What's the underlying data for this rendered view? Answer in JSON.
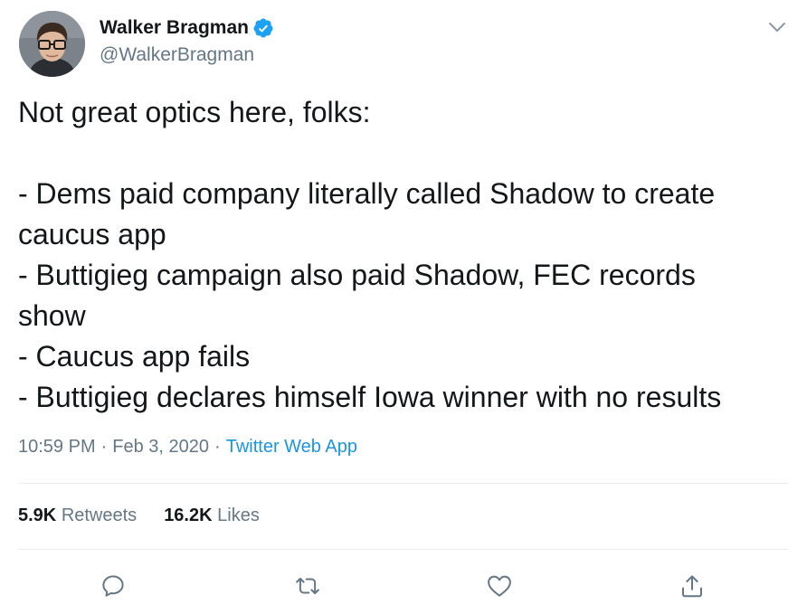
{
  "author": {
    "display_name": "Walker Bragman",
    "handle": "@WalkerBragman",
    "verified": true
  },
  "tweet": {
    "lines": [
      "Not great optics here, folks:",
      "",
      "- Dems paid company literally called Shadow to create",
      "caucus app",
      "- Buttigieg campaign also paid Shadow, FEC records",
      "show",
      "- Caucus app fails",
      "- Buttigieg declares himself Iowa winner with no results"
    ],
    "time": "10:59 PM",
    "separator": "·",
    "date": "Feb 3, 2020",
    "source": "Twitter Web App"
  },
  "stats": {
    "retweets_count": "5.9K",
    "retweets_label": "Retweets",
    "likes_count": "16.2K",
    "likes_label": "Likes"
  },
  "icons": {
    "verified": "verified-badge-icon",
    "caret": "chevron-down-icon",
    "reply": "reply-icon",
    "retweet": "retweet-icon",
    "like": "heart-icon",
    "share": "share-icon"
  },
  "colors": {
    "text": "#14171a",
    "secondary": "#657786",
    "link": "#1b95e0",
    "verified": "#1da1f2",
    "divider": "#e6ecf0"
  }
}
